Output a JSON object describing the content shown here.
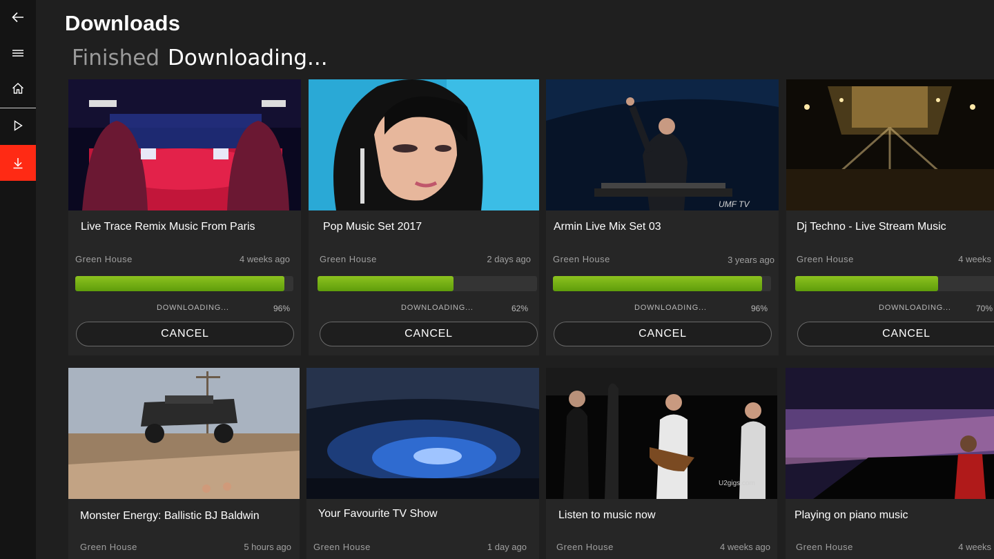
{
  "header": {
    "title": "Downloads",
    "tabs": [
      {
        "label": "Finished"
      },
      {
        "label": "Downloading..."
      }
    ]
  },
  "sidebar": {
    "items": [
      {
        "icon": "back-arrow-icon"
      },
      {
        "icon": "hamburger-menu-icon"
      },
      {
        "icon": "home-icon"
      },
      {
        "icon": "play-icon"
      },
      {
        "icon": "download-icon",
        "active": true
      }
    ],
    "accent_color": "#ff2a14"
  },
  "downloads": [
    {
      "title": "Live Trace Remix Music From Paris",
      "channel": "Green House",
      "time": "4 weeks ago",
      "status": "DOWNLOADING...",
      "percent_label": "96%",
      "progress": 0.96,
      "action": "CANCEL"
    },
    {
      "title": "Pop Music Set 2017",
      "channel": "Green House",
      "time": "2 days ago",
      "status": "DOWNLOADING...",
      "percent_label": "62%",
      "progress": 0.62,
      "action": "CANCEL"
    },
    {
      "title": "Armin Live Mix Set 03",
      "channel": "Green House",
      "time": "3 years ago",
      "status": "DOWNLOADING...",
      "percent_label": "96%",
      "progress": 0.96,
      "action": "CANCEL",
      "thumb_watermark": "UMF TV"
    },
    {
      "title": "Dj Techno - Live Stream Music",
      "channel": "Green House",
      "time": "4 weeks",
      "status": "DOWNLOADING...",
      "percent_label": "70%",
      "progress": 0.7,
      "action": "CANCEL"
    }
  ],
  "videos": [
    {
      "title": "Monster Energy: Ballistic BJ Baldwin",
      "channel": "Green House",
      "time": "5 hours ago"
    },
    {
      "title": "Your Favourite TV Show",
      "channel": "Green House",
      "time": "1 day ago"
    },
    {
      "title": "Listen to music now",
      "channel": "Green House",
      "time": "4 weeks ago",
      "thumb_watermark": "U2gigs.com"
    },
    {
      "title": "Playing on piano music",
      "channel": "Green House",
      "time": "4 weeks"
    }
  ],
  "colors": {
    "background": "#1f1f1f",
    "card": "#262626",
    "progress": "#7ab315"
  }
}
